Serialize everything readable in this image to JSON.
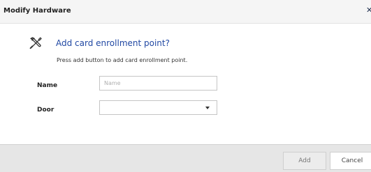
{
  "window": {
    "title": "Modify Hardware",
    "close_glyph": "✕"
  },
  "header": {
    "icon": "tools-icon",
    "heading": "Add card enrollment point?",
    "subtext": "Press add button to add card enrollment point."
  },
  "form": {
    "name": {
      "label": "Name",
      "placeholder": "Name",
      "value": ""
    },
    "door": {
      "label": "Door",
      "selected": ""
    }
  },
  "footer": {
    "add_label": "Add",
    "cancel_label": "Cancel"
  },
  "colors": {
    "heading": "#2148a3",
    "footer_bg": "#e6e6e6",
    "titlebar_bg": "#f5f5f5"
  }
}
